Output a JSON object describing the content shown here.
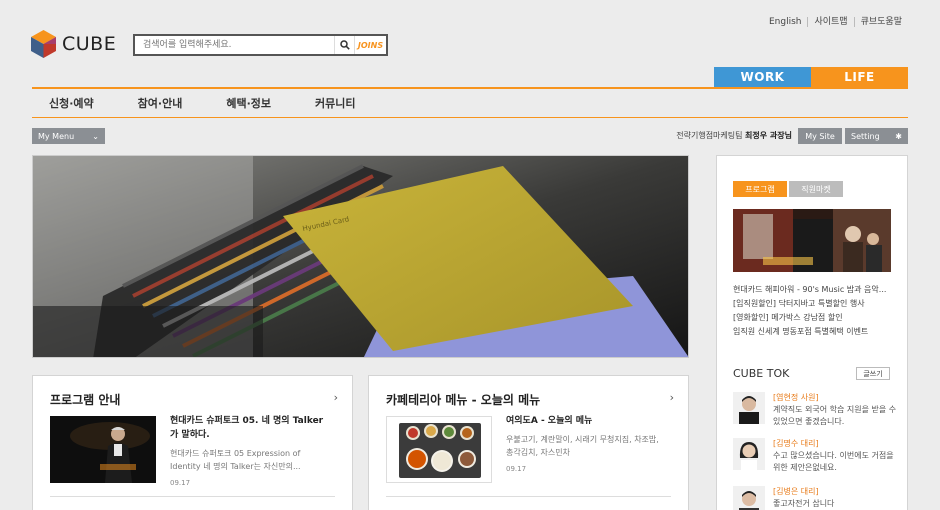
{
  "header": {
    "util_links": [
      "English",
      "사이트맵",
      "큐브도움말"
    ],
    "logo_text": "CUBE",
    "search_placeholder": "검색어를 입력해주세요.",
    "search_partner": "JOINS"
  },
  "top_tabs": [
    "WORK",
    "LIFE"
  ],
  "gnb": [
    "신청·예약",
    "참여·안내",
    "혜택·정보",
    "커뮤니티"
  ],
  "subbar": {
    "my_menu": "My Menu",
    "user_dept": "전략기행점마케팅팀",
    "user_name": "최정우 과장님",
    "my_site": "My Site",
    "setting": "Setting"
  },
  "right_panel": {
    "tabs": [
      "프로그램",
      "직원마켓"
    ],
    "list": [
      "현대카드 해피아워 - 90's Music 밤과 음악...",
      "[임직원할인] 닥터지바고 특별할인 행사",
      "[영화할인] 메가박스 강남점 할인",
      "임직원 신세계 명동포점 특별혜택 이벤트"
    ],
    "cube_tok_title": "CUBE TOK",
    "write_button": "글쓰기",
    "tok_items": [
      {
        "name": "[염현정 사원]",
        "text": "계약직도 외국어 학습 지원을 받을 수 있었으면 좋겠습니다."
      },
      {
        "name": "[김명수 대리]",
        "text": "수고 많으셨습니다. 이번에도 거점을 위한 제안은없네요."
      },
      {
        "name": "[김병은 대리]",
        "text": "좋고자전거 삽니다"
      }
    ]
  },
  "cards": [
    {
      "title": "프로그램 안내",
      "more": "›",
      "head": "현대카드 슈퍼토크 05. 네 명의 Talker가 말하다.",
      "desc": "현대카드 슈퍼토크 05 Expression of Identity 네 명의 Talker는 자신만의...",
      "date": "09.17"
    },
    {
      "title": "카페테리아 메뉴 - 오늘의 메뉴",
      "more": "›",
      "head": "여의도A - 오늘의 메뉴",
      "desc": "우불고기, 계란말이, 시래기 무청지짐, 차조밥, 총각김치, 자스민차",
      "date": "09.17"
    }
  ],
  "hero": {
    "card_text": "Hyundai Card"
  },
  "colors": {
    "orange": "#f7941d",
    "blue": "#3f97d5",
    "button_gray": "#8b8f94"
  }
}
